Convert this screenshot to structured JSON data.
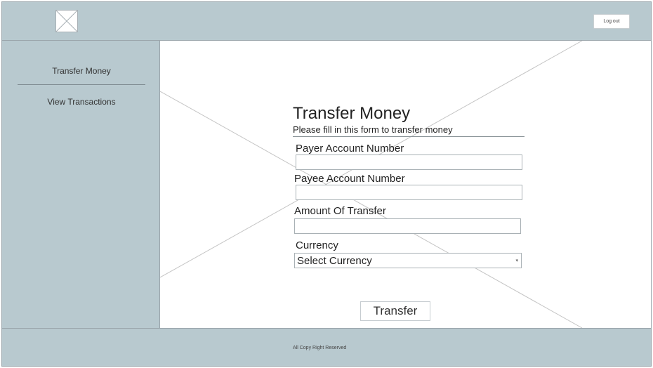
{
  "header": {
    "logo_icon": "image-placeholder-icon",
    "logout_label": "Log out"
  },
  "sidebar": {
    "items": [
      {
        "label": "Transfer Money"
      },
      {
        "label": "View Transactions"
      }
    ]
  },
  "form": {
    "title": "Transfer Money",
    "subtitle": "Please fill in this form to transfer money",
    "payer_label": "Payer Account Number",
    "payer_value": "",
    "payee_label": "Payee Account Number",
    "payee_value": "",
    "amount_label": "Amount Of Transfer",
    "amount_value": "",
    "currency_label": "Currency",
    "currency_selected": "Select Currency",
    "submit_label": "Transfer"
  },
  "footer": {
    "text": "All Copy Right Reserved"
  },
  "colors": {
    "chrome_bg": "#b8c9cf",
    "content_bg": "#ffffff",
    "border": "#9aa5ab"
  }
}
